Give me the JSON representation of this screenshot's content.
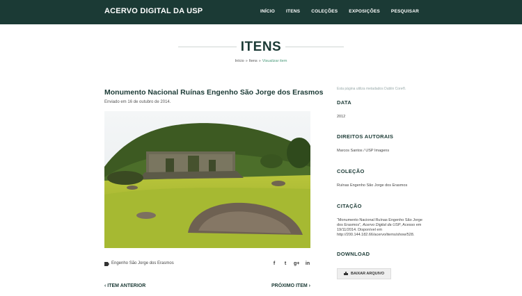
{
  "header": {
    "brand": "ACERVO DIGITAL DA USP",
    "nav": [
      "INÍCIO",
      "ITENS",
      "COLEÇÕES",
      "EXPOSIÇÕES",
      "PESQUISAR"
    ]
  },
  "page": {
    "title": "ITENS",
    "breadcrumb": {
      "home": "Início",
      "items": "Itens",
      "current": "Visualizar item",
      "sep": "»"
    }
  },
  "item": {
    "title": "Monumento Nacional Ruínas Engenho São Jorge dos Erasmos",
    "date": "Enviado em 16 de outubro de 2014.",
    "tag": "Engenho São Jorge dos Erasmos",
    "social": {
      "facebook": "f",
      "twitter": "t",
      "google": "g+",
      "linkedin": "in"
    }
  },
  "pager": {
    "prev": "ITEM ANTERIOR",
    "next": "PRÓXIMO ITEM"
  },
  "sidebar": {
    "note": "Esta página utiliza metadados Dublin Core®.",
    "date_label": "DATA",
    "date_value": "2012",
    "rights_label": "DIREITOS AUTORAIS",
    "rights_value": "Marcos Santos / USP Imagens",
    "collection_label": "COLEÇÃO",
    "collection_value": "Ruínas Engenho São Jorge dos Erasmos",
    "citation_label": "CITAÇÃO",
    "citation_part1": "“Monumento Nacional Ruínas Engenho São Jorge dos Erasmos”,",
    "citation_italic": "Acervo Digital da USP",
    "citation_part2": ", Acesso em 19/11/2014. Disponível em http://200.144.182.66/acervo/items/show/528.",
    "download_label": "DOWNLOAD",
    "download_button": "BAIXAR ARQUIVO"
  }
}
